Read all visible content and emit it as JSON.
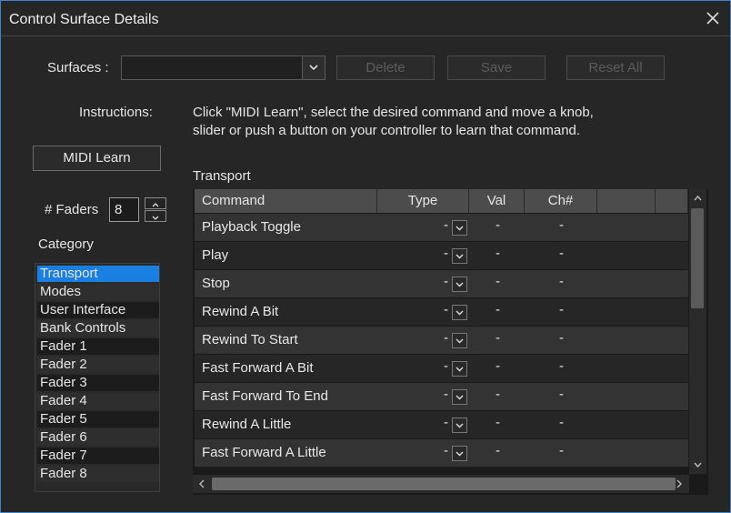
{
  "window": {
    "title": "Control Surface Details"
  },
  "surfaces": {
    "label": "Surfaces :",
    "value": ""
  },
  "buttons": {
    "delete": "Delete",
    "save": "Save",
    "reset_all": "Reset All",
    "midi_learn": "MIDI Learn"
  },
  "instructions": {
    "label": "Instructions:",
    "line1": "Click \"MIDI Learn\", select the desired command and move a knob,",
    "line2": "slider or push a button on your controller to learn that command."
  },
  "faders": {
    "label": "# Faders",
    "value": "8"
  },
  "category": {
    "label": "Category",
    "selected": "Transport",
    "items": [
      "Transport",
      "Modes",
      "User Interface",
      "Bank Controls",
      "Fader  1",
      "Fader  2",
      "Fader  3",
      "Fader  4",
      "Fader  5",
      "Fader  6",
      "Fader  7",
      "Fader  8"
    ]
  },
  "transport": {
    "section_label": "Transport",
    "columns": [
      "Command",
      "Type",
      "Val",
      "Ch#"
    ],
    "rows": [
      {
        "command": "Playback Toggle",
        "type": "-",
        "val": "-",
        "ch": "-"
      },
      {
        "command": "Play",
        "type": "-",
        "val": "-",
        "ch": "-"
      },
      {
        "command": "Stop",
        "type": "-",
        "val": "-",
        "ch": "-"
      },
      {
        "command": "Rewind A Bit",
        "type": "-",
        "val": "-",
        "ch": "-"
      },
      {
        "command": "Rewind To Start",
        "type": "-",
        "val": "-",
        "ch": "-"
      },
      {
        "command": "Fast Forward A Bit",
        "type": "-",
        "val": "-",
        "ch": "-"
      },
      {
        "command": "Fast Forward To End",
        "type": "-",
        "val": "-",
        "ch": "-"
      },
      {
        "command": "Rewind A Little",
        "type": "-",
        "val": "-",
        "ch": "-"
      },
      {
        "command": "Fast Forward A Little",
        "type": "-",
        "val": "-",
        "ch": "-"
      }
    ]
  },
  "colors": {
    "selection": "#1a7fe0",
    "window_border": "#3a86c8",
    "background": "#262626"
  }
}
